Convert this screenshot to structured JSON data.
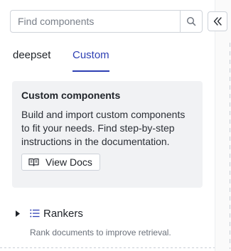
{
  "search": {
    "placeholder": "Find components"
  },
  "tabs": [
    {
      "label": "deepset",
      "active": false
    },
    {
      "label": "Custom",
      "active": true
    }
  ],
  "card": {
    "title": "Custom components",
    "body": "Build and import custom components to fit your needs. Find step-by-step instructions in the documentation.",
    "button_label": "View Docs"
  },
  "groups": [
    {
      "name": "Rankers",
      "description": "Rank documents to improve retrieval.",
      "expanded": false
    }
  ],
  "colors": {
    "accent": "#2d3fb3",
    "card_bg": "#f1f2f4",
    "muted_text": "#6b717b"
  },
  "icons": {
    "search": "search-icon",
    "collapse": "double-chevron-left-icon",
    "docs": "book-open-icon",
    "caret": "caret-right-icon",
    "list": "list-icon"
  }
}
